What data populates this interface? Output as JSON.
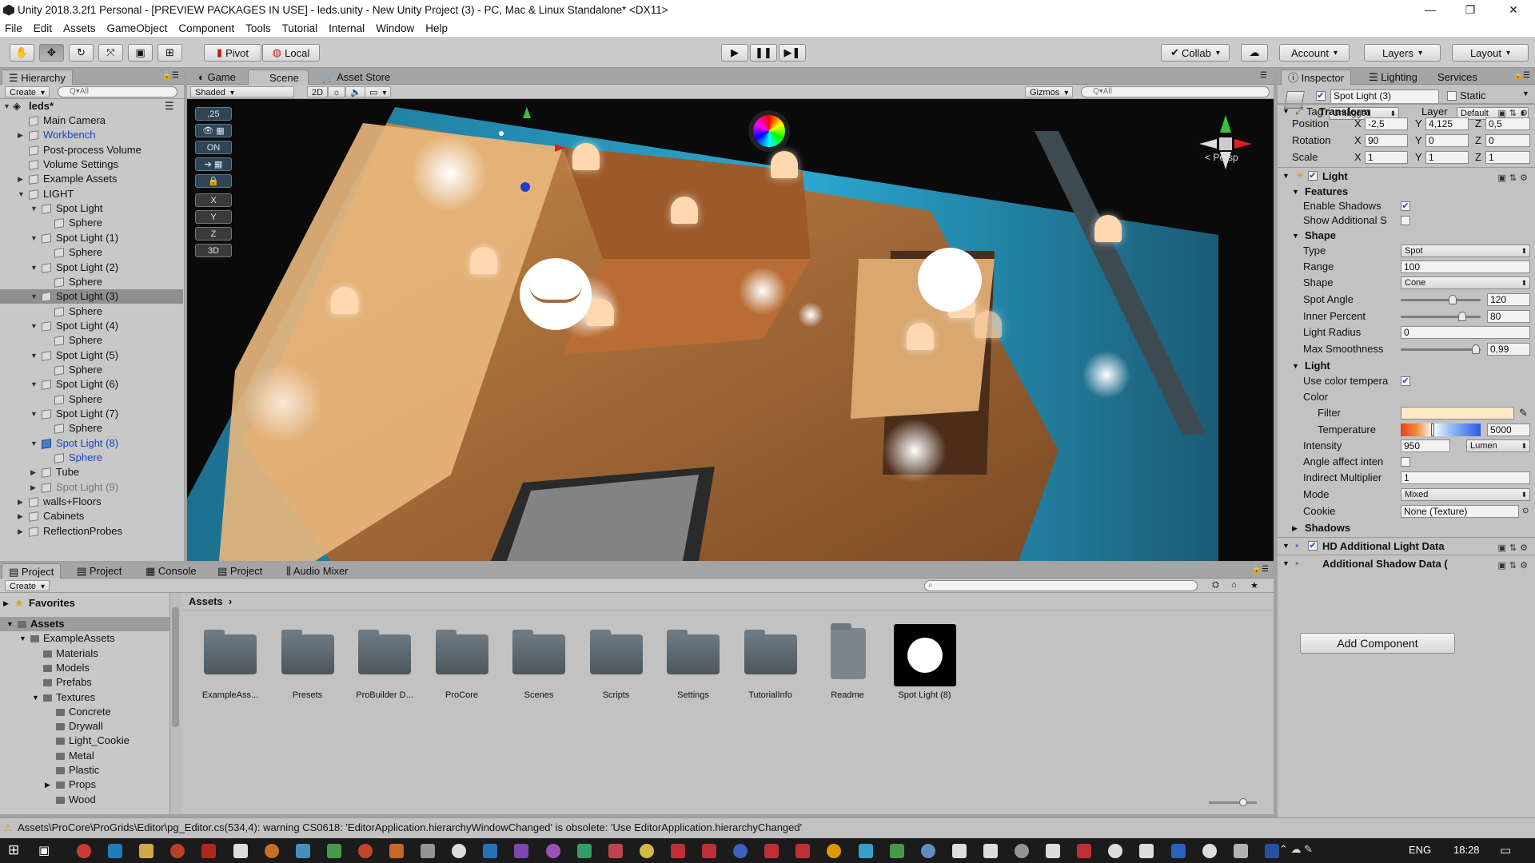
{
  "window": {
    "title": "Unity 2018.3.2f1 Personal - [PREVIEW PACKAGES IN USE] - leds.unity - New Unity Project (3) - PC, Mac & Linux Standalone* <DX11>",
    "minimize": "—",
    "maximize": "❐",
    "close": "✕"
  },
  "menu": [
    "File",
    "Edit",
    "Assets",
    "GameObject",
    "Component",
    "Tools",
    "Tutorial",
    "Internal",
    "Window",
    "Help"
  ],
  "toolbar": {
    "pivot": "Pivot",
    "local": "Local",
    "collab": "Collab",
    "account": "Account",
    "layers": "Layers",
    "layout": "Layout"
  },
  "hierarchy": {
    "tab": "Hierarchy",
    "create": "Create",
    "search_placeholder": "Q▾All",
    "scene_name": "leds*",
    "items": [
      {
        "label": "Main Camera",
        "depth": 1
      },
      {
        "label": "Workbench",
        "depth": 1,
        "style": "blue",
        "arrow": "▶"
      },
      {
        "label": "Post-process Volume",
        "depth": 1
      },
      {
        "label": "Volume Settings",
        "depth": 1
      },
      {
        "label": "Example Assets",
        "depth": 1,
        "arrow": "▶"
      },
      {
        "label": "LIGHT",
        "depth": 1,
        "arrow": "▼"
      },
      {
        "label": "Spot Light",
        "depth": 2,
        "arrow": "▼"
      },
      {
        "label": "Sphere",
        "depth": 3
      },
      {
        "label": "Spot Light (1)",
        "depth": 2,
        "arrow": "▼"
      },
      {
        "label": "Sphere",
        "depth": 3
      },
      {
        "label": "Spot Light (2)",
        "depth": 2,
        "arrow": "▼"
      },
      {
        "label": "Sphere",
        "depth": 3
      },
      {
        "label": "Spot Light (3)",
        "depth": 2,
        "arrow": "▼",
        "selected": true
      },
      {
        "label": "Sphere",
        "depth": 3
      },
      {
        "label": "Spot Light (4)",
        "depth": 2,
        "arrow": "▼"
      },
      {
        "label": "Sphere",
        "depth": 3
      },
      {
        "label": "Spot Light (5)",
        "depth": 2,
        "arrow": "▼"
      },
      {
        "label": "Sphere",
        "depth": 3
      },
      {
        "label": "Spot Light (6)",
        "depth": 2,
        "arrow": "▼"
      },
      {
        "label": "Sphere",
        "depth": 3
      },
      {
        "label": "Spot Light (7)",
        "depth": 2,
        "arrow": "▼"
      },
      {
        "label": "Sphere",
        "depth": 3
      },
      {
        "label": "Spot Light (8)",
        "depth": 2,
        "arrow": "▼",
        "style": "blue"
      },
      {
        "label": "Sphere",
        "depth": 3,
        "style": "blue"
      },
      {
        "label": "Tube",
        "depth": 2,
        "arrow": "▶"
      },
      {
        "label": "Spot Light (9)",
        "depth": 2,
        "arrow": "▶",
        "style": "grey"
      },
      {
        "label": "walls+Floors",
        "depth": 1,
        "arrow": "▶"
      },
      {
        "label": "Cabinets",
        "depth": 1,
        "arrow": "▶"
      },
      {
        "label": "ReflectionProbes",
        "depth": 1,
        "arrow": "▶"
      }
    ]
  },
  "scene": {
    "tabs": [
      "Game",
      "Scene",
      "Asset Store"
    ],
    "shading": "Shaded",
    "mode_2d": "2D",
    "gizmos": "Gizmos",
    "search_placeholder": "Q▾All",
    "persp": "Persp",
    "tool_buttons": [
      ",25",
      "",
      "ON",
      "",
      "",
      "X",
      "Y",
      "Z",
      "3D"
    ]
  },
  "inspector": {
    "tabs": [
      "Inspector",
      "Lighting",
      "Services"
    ],
    "object_name": "Spot Light (3)",
    "static_label": "Static",
    "tag_label": "Tag",
    "tag_value": "Untagged",
    "layer_label": "Layer",
    "layer_value": "Default",
    "transform": {
      "title": "Transform",
      "rows": [
        {
          "label": "Position",
          "x": "-2,5",
          "y": "4,125",
          "z": "0,5"
        },
        {
          "label": "Rotation",
          "x": "90",
          "y": "0",
          "z": "0"
        },
        {
          "label": "Scale",
          "x": "1",
          "y": "1",
          "z": "1"
        }
      ]
    },
    "light": {
      "title": "Light",
      "features": "Features",
      "enable_shadows": "Enable Shadows",
      "show_additional": "Show Additional S",
      "shape_section": "Shape",
      "type_label": "Type",
      "type_value": "Spot",
      "range_label": "Range",
      "range_value": "100",
      "shape_label": "Shape",
      "shape_value": "Cone",
      "spot_angle_label": "Spot Angle",
      "spot_angle_value": "120",
      "spot_angle_fraction": 0.67,
      "inner_label": "Inner Percent",
      "inner_value": "80",
      "inner_fraction": 0.8,
      "radius_label": "Light Radius",
      "radius_value": "0",
      "smooth_label": "Max Smoothness",
      "smooth_value": "0,99",
      "smooth_fraction": 0.99,
      "light_section": "Light",
      "use_color_temp": "Use color tempera",
      "color_label": "Color",
      "filter_label": "Filter",
      "filter_color": "#fde9c7",
      "temperature_label": "Temperature",
      "temperature_value": "5000",
      "intensity_label": "Intensity",
      "intensity_value": "950",
      "intensity_unit": "Lumen",
      "angle_affect": "Angle affect inten",
      "indirect_label": "Indirect Multiplier",
      "indirect_value": "1",
      "mode_label": "Mode",
      "mode_value": "Mixed",
      "cookie_label": "Cookie",
      "cookie_value": "None (Texture)",
      "shadows_section": "Shadows"
    },
    "hd_light_data": "HD Additional Light Data",
    "shadow_data": "Additional Shadow Data (",
    "add_component": "Add Component"
  },
  "project": {
    "tabs": [
      "Project",
      "Project",
      "Console",
      "Project",
      "Audio Mixer"
    ],
    "create": "Create",
    "breadcrumb": "Assets",
    "favorites": "Favorites",
    "tree": [
      {
        "label": "Assets",
        "depth": 0,
        "arrow": "▼",
        "bold": true
      },
      {
        "label": "ExampleAssets",
        "depth": 1,
        "arrow": "▼"
      },
      {
        "label": "Materials",
        "depth": 2
      },
      {
        "label": "Models",
        "depth": 2
      },
      {
        "label": "Prefabs",
        "depth": 2
      },
      {
        "label": "Textures",
        "depth": 2,
        "arrow": "▼"
      },
      {
        "label": "Concrete",
        "depth": 3
      },
      {
        "label": "Drywall",
        "depth": 3
      },
      {
        "label": "Light_Cookie",
        "depth": 3
      },
      {
        "label": "Metal",
        "depth": 3
      },
      {
        "label": "Plastic",
        "depth": 3
      },
      {
        "label": "Props",
        "depth": 3,
        "arrow": "▶"
      },
      {
        "label": "Wood",
        "depth": 3
      }
    ],
    "assets": [
      {
        "label": "ExampleAss...",
        "kind": "folder"
      },
      {
        "label": "Presets",
        "kind": "folder"
      },
      {
        "label": "ProBuilder D...",
        "kind": "folder"
      },
      {
        "label": "ProCore",
        "kind": "folder"
      },
      {
        "label": "Scenes",
        "kind": "folder"
      },
      {
        "label": "Scripts",
        "kind": "folder"
      },
      {
        "label": "Settings",
        "kind": "folder"
      },
      {
        "label": "TutorialInfo",
        "kind": "folder"
      },
      {
        "label": "Readme",
        "kind": "unity"
      },
      {
        "label": "Spot Light (8)",
        "kind": "prefab"
      }
    ]
  },
  "status": {
    "message": "Assets\\ProCore\\ProGrids\\Editor\\pg_Editor.cs(534,4): warning CS0618: 'EditorApplication.hierarchyWindowChanged' is obsolete: 'Use EditorApplication.hierarchyChanged'"
  },
  "taskbar": {
    "lang": "ENG",
    "time": "18:28"
  }
}
